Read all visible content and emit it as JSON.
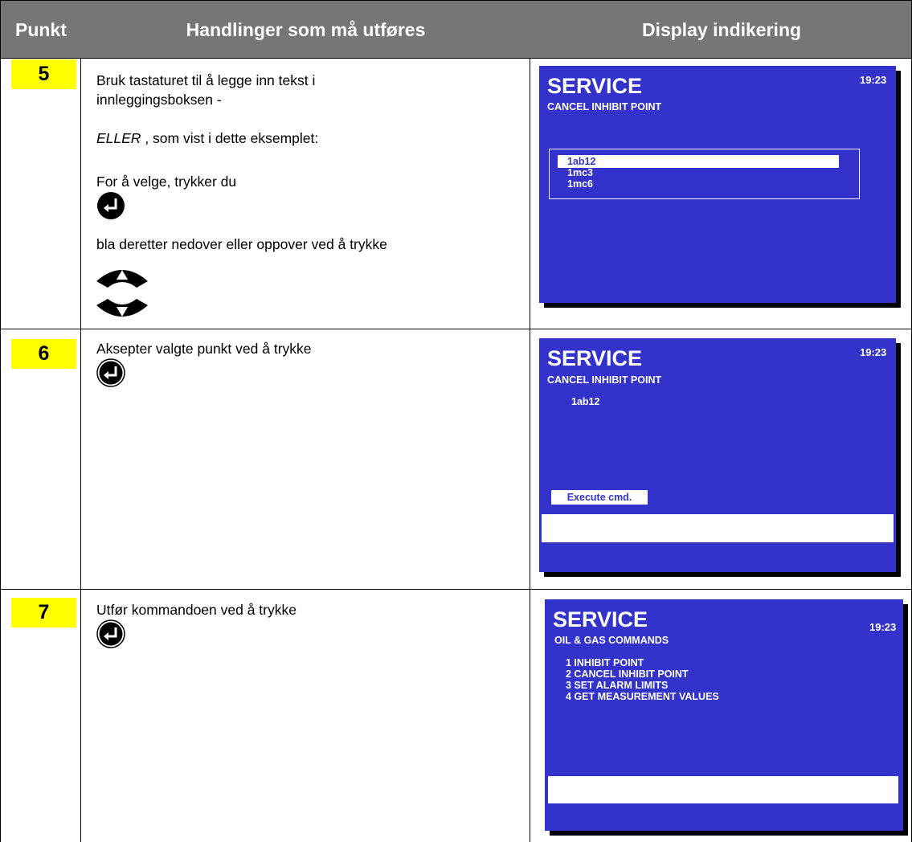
{
  "header": {
    "col1": "Punkt",
    "col2": "Handlinger som må utføres",
    "col3": "Display indikering"
  },
  "colors": {
    "header_bg": "#767676",
    "badge": "#ffff00",
    "screen_bg": "#3333cc"
  },
  "rows": [
    {
      "number": "5",
      "text": {
        "line1": "Bruk tastaturet til å legge inn tekst i innleggingsboksen -",
        "eller": "ELLER",
        "eller_rest": " , som vist i dette eksemplet:",
        "line3": "For å velge, trykker du",
        "line4": "bla deretter nedover eller oppover ved å trykke"
      },
      "icons": [
        "enter-key-icon",
        "arrow-up-key-icon",
        "arrow-down-key-icon"
      ],
      "screen": {
        "title": "SERVICE",
        "time": "19:23",
        "subtitle": "CANCEL INHIBIT POINT",
        "list": [
          "1ab12",
          "1mc3",
          "1mc6"
        ],
        "selected_index": 0
      }
    },
    {
      "number": "6",
      "text": {
        "line1": "Aksepter valgte punkt ved å trykke"
      },
      "icons": [
        "enter-key-icon"
      ],
      "screen": {
        "title": "SERVICE",
        "time": "19:23",
        "subtitle": "CANCEL INHIBIT POINT",
        "value": "1ab12",
        "execute": "Execute cmd."
      }
    },
    {
      "number": "7",
      "text": {
        "line1": "Utfør kommandoen ved å trykke"
      },
      "icons": [
        "enter-key-icon"
      ],
      "screen": {
        "title": "SERVICE",
        "time": "19:23",
        "subtitle": "OIL & GAS COMMANDS",
        "menu": [
          "1 INHIBIT POINT",
          "2 CANCEL INHIBIT POINT",
          "3 SET ALARM LIMITS",
          "4 GET MEASUREMENT VALUES"
        ]
      }
    }
  ]
}
